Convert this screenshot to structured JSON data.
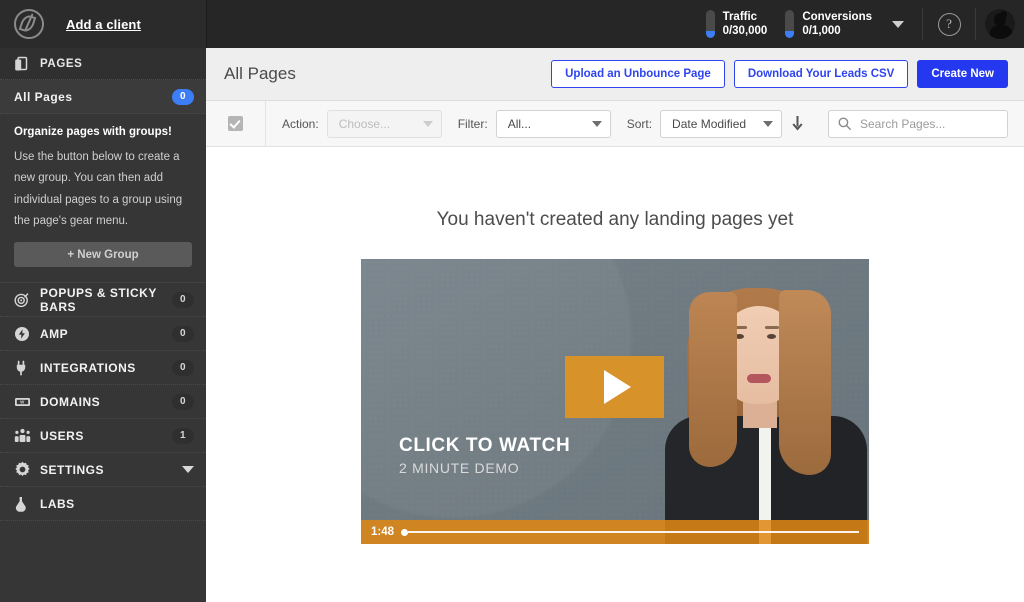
{
  "topbar": {
    "logo_name": "unbounce-logo",
    "add_client_label": "Add a client",
    "meters": [
      {
        "label": "Traffic",
        "value": "0/30,000",
        "icon": "gauge-icon"
      },
      {
        "label": "Conversions",
        "value": "0/1,000",
        "icon": "gauge-icon"
      }
    ],
    "caret_icon": "chevron-down-icon",
    "help_icon": "question-mark-icon",
    "help_label": "?",
    "avatar_icon": "user-avatar-icon"
  },
  "sidebar": {
    "section_header": {
      "label": "PAGES",
      "icon": "pages-icon"
    },
    "all_pages": {
      "label": "All Pages",
      "badge": "0",
      "badge_color": "#3d7ef7"
    },
    "group_promo": {
      "title": "Organize pages with groups!",
      "body": "Use the button below to create a new group. You can then add individual pages to a group using the page's gear menu.",
      "button_label": "+ New Group"
    },
    "items": [
      {
        "label": "POPUPS & STICKY BARS",
        "badge": "0",
        "icon": "target-icon"
      },
      {
        "label": "AMP",
        "badge": "0",
        "icon": "lightning-bolt-icon"
      },
      {
        "label": "INTEGRATIONS",
        "badge": "0",
        "icon": "plug-icon"
      },
      {
        "label": "DOMAINS",
        "badge": "0",
        "icon": "domain-icon"
      },
      {
        "label": "USERS",
        "badge": "1",
        "icon": "users-icon"
      },
      {
        "label": "SETTINGS",
        "badge": "",
        "icon": "gear-icon",
        "has_caret": true
      },
      {
        "label": "LABS",
        "badge": "",
        "icon": "flask-icon"
      }
    ]
  },
  "page_header": {
    "title": "All Pages",
    "buttons": [
      {
        "label": "Upload an Unbounce Page",
        "style": "outline"
      },
      {
        "label": "Download Your Leads CSV",
        "style": "outline"
      },
      {
        "label": "Create New",
        "style": "primary"
      }
    ],
    "primary_color": "#2438f0"
  },
  "toolbar": {
    "select_all_checkbox": {
      "checked": true
    },
    "action": {
      "label": "Action:",
      "value": "Choose...",
      "disabled": true
    },
    "filter": {
      "label": "Filter:",
      "value": "All...",
      "disabled": false
    },
    "sort": {
      "label": "Sort:",
      "value": "Date Modified",
      "disabled": false
    },
    "sort_direction_icon": "arrow-down-icon",
    "search": {
      "placeholder": "Search Pages...",
      "value": "",
      "icon": "search-icon"
    }
  },
  "content": {
    "empty_title": "You haven't created any landing pages yet",
    "video": {
      "cta_line1": "CLICK TO WATCH",
      "cta_line2": "2 MINUTE DEMO",
      "play_icon": "play-icon",
      "time": "1:48",
      "accent_color": "#d8922a"
    }
  }
}
